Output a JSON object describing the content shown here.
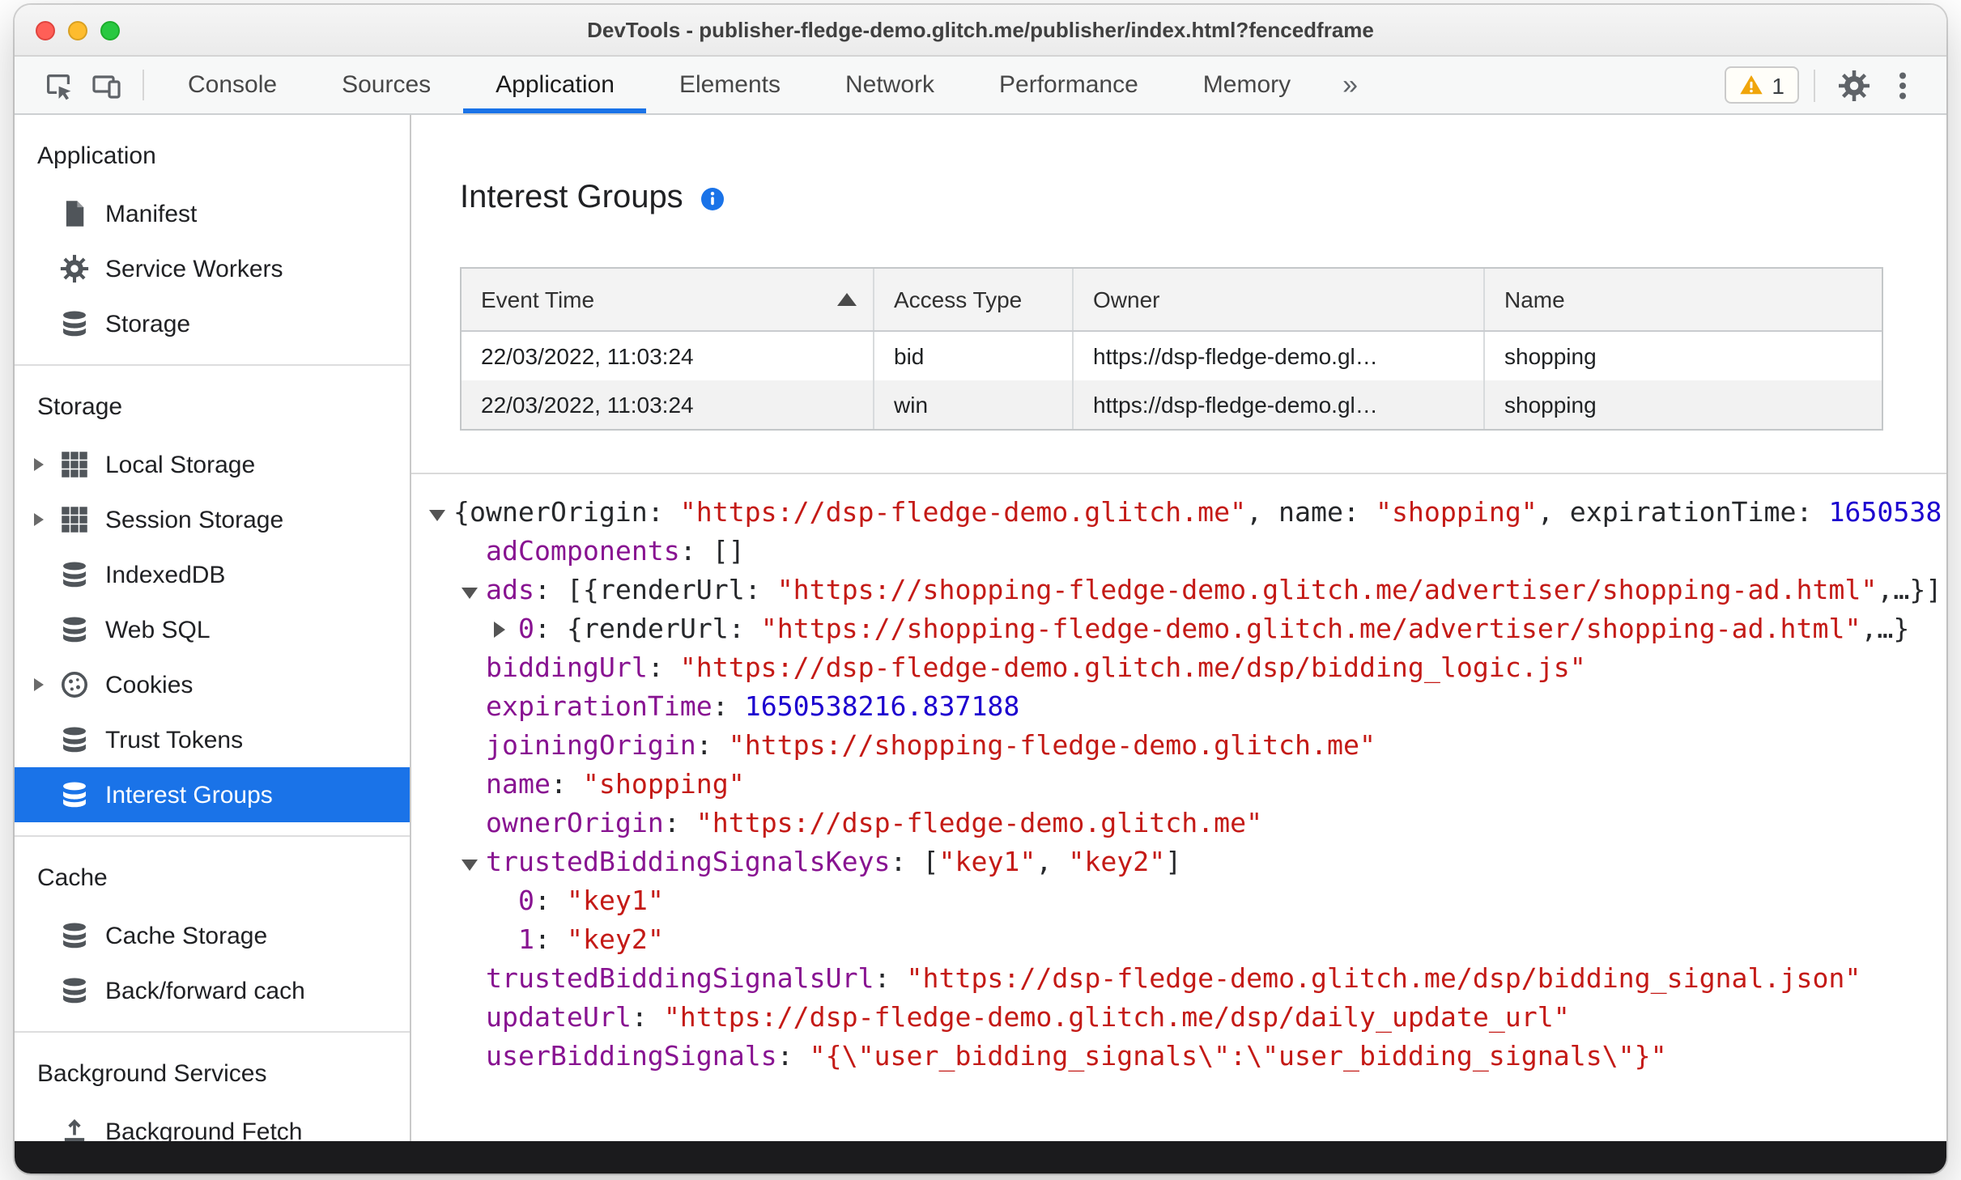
{
  "window": {
    "title": "DevTools - publisher-fledge-demo.glitch.me/publisher/index.html?fencedframe"
  },
  "toolbar": {
    "tabs": [
      {
        "label": "Console",
        "active": false
      },
      {
        "label": "Sources",
        "active": false
      },
      {
        "label": "Application",
        "active": true
      },
      {
        "label": "Elements",
        "active": false
      },
      {
        "label": "Network",
        "active": false
      },
      {
        "label": "Performance",
        "active": false
      },
      {
        "label": "Memory",
        "active": false
      }
    ],
    "more_tabs_symbol": "»",
    "warning_count": "1"
  },
  "sidebar": {
    "sections": [
      {
        "heading": "Application",
        "items": [
          {
            "label": "Manifest",
            "icon": "document-icon"
          },
          {
            "label": "Service Workers",
            "icon": "gear-icon"
          },
          {
            "label": "Storage",
            "icon": "database-icon"
          }
        ]
      },
      {
        "heading": "Storage",
        "items": [
          {
            "label": "Local Storage",
            "icon": "table-icon",
            "expandable": true
          },
          {
            "label": "Session Storage",
            "icon": "table-icon",
            "expandable": true
          },
          {
            "label": "IndexedDB",
            "icon": "database-icon"
          },
          {
            "label": "Web SQL",
            "icon": "database-icon"
          },
          {
            "label": "Cookies",
            "icon": "cookie-icon",
            "expandable": true
          },
          {
            "label": "Trust Tokens",
            "icon": "database-icon"
          },
          {
            "label": "Interest Groups",
            "icon": "database-icon",
            "selected": true
          }
        ]
      },
      {
        "heading": "Cache",
        "items": [
          {
            "label": "Cache Storage",
            "icon": "database-icon"
          },
          {
            "label": "Back/forward cach",
            "icon": "database-icon"
          }
        ]
      },
      {
        "heading": "Background Services",
        "items": [
          {
            "label": "Background Fetch",
            "icon": "fetch-icon"
          }
        ]
      }
    ]
  },
  "main": {
    "title": "Interest Groups",
    "table": {
      "columns": [
        "Event Time",
        "Access Type",
        "Owner",
        "Name"
      ],
      "sorted_column": "Event Time",
      "sort_direction": "ascending",
      "rows": [
        [
          "22/03/2022, 11:03:24",
          "bid",
          "https://dsp-fledge-demo.gl…",
          "shopping"
        ],
        [
          "22/03/2022, 11:03:24",
          "win",
          "https://dsp-fledge-demo.gl…",
          "shopping"
        ]
      ]
    },
    "tree": {
      "lines": [
        {
          "indent": 0,
          "arrow": "down",
          "segments": [
            {
              "t": "{ownerOrigin: ",
              "c": "p"
            },
            {
              "t": "\"https://dsp-fledge-demo.glitch.me\"",
              "c": "s"
            },
            {
              "t": ", name: ",
              "c": "p"
            },
            {
              "t": "\"shopping\"",
              "c": "s"
            },
            {
              "t": ", expirationTime: ",
              "c": "p"
            },
            {
              "t": "1650538",
              "c": "n"
            }
          ]
        },
        {
          "indent": 1,
          "arrow": null,
          "segments": [
            {
              "t": "adComponents",
              "c": "k"
            },
            {
              "t": ": []",
              "c": "p"
            }
          ]
        },
        {
          "indent": 1,
          "arrow": "down",
          "segments": [
            {
              "t": "ads",
              "c": "k"
            },
            {
              "t": ": [{renderUrl: ",
              "c": "p"
            },
            {
              "t": "\"https://shopping-fledge-demo.glitch.me/advertiser/shopping-ad.html\"",
              "c": "s"
            },
            {
              "t": ",…}]",
              "c": "p"
            }
          ]
        },
        {
          "indent": 2,
          "arrow": "right",
          "segments": [
            {
              "t": "0",
              "c": "k"
            },
            {
              "t": ": {renderUrl: ",
              "c": "p"
            },
            {
              "t": "\"https://shopping-fledge-demo.glitch.me/advertiser/shopping-ad.html\"",
              "c": "s"
            },
            {
              "t": ",…}",
              "c": "p"
            }
          ]
        },
        {
          "indent": 1,
          "arrow": null,
          "segments": [
            {
              "t": "biddingUrl",
              "c": "k"
            },
            {
              "t": ": ",
              "c": "p"
            },
            {
              "t": "\"https://dsp-fledge-demo.glitch.me/dsp/bidding_logic.js\"",
              "c": "s"
            }
          ]
        },
        {
          "indent": 1,
          "arrow": null,
          "segments": [
            {
              "t": "expirationTime",
              "c": "k"
            },
            {
              "t": ": ",
              "c": "p"
            },
            {
              "t": "1650538216.837188",
              "c": "n"
            }
          ]
        },
        {
          "indent": 1,
          "arrow": null,
          "segments": [
            {
              "t": "joiningOrigin",
              "c": "k"
            },
            {
              "t": ": ",
              "c": "p"
            },
            {
              "t": "\"https://shopping-fledge-demo.glitch.me\"",
              "c": "s"
            }
          ]
        },
        {
          "indent": 1,
          "arrow": null,
          "segments": [
            {
              "t": "name",
              "c": "k"
            },
            {
              "t": ": ",
              "c": "p"
            },
            {
              "t": "\"shopping\"",
              "c": "s"
            }
          ]
        },
        {
          "indent": 1,
          "arrow": null,
          "segments": [
            {
              "t": "ownerOrigin",
              "c": "k"
            },
            {
              "t": ": ",
              "c": "p"
            },
            {
              "t": "\"https://dsp-fledge-demo.glitch.me\"",
              "c": "s"
            }
          ]
        },
        {
          "indent": 1,
          "arrow": "down",
          "segments": [
            {
              "t": "trustedBiddingSignalsKeys",
              "c": "k"
            },
            {
              "t": ": [",
              "c": "p"
            },
            {
              "t": "\"key1\"",
              "c": "s"
            },
            {
              "t": ", ",
              "c": "p"
            },
            {
              "t": "\"key2\"",
              "c": "s"
            },
            {
              "t": "]",
              "c": "p"
            }
          ]
        },
        {
          "indent": 2,
          "arrow": null,
          "segments": [
            {
              "t": "0",
              "c": "k"
            },
            {
              "t": ": ",
              "c": "p"
            },
            {
              "t": "\"key1\"",
              "c": "s"
            }
          ]
        },
        {
          "indent": 2,
          "arrow": null,
          "segments": [
            {
              "t": "1",
              "c": "k"
            },
            {
              "t": ": ",
              "c": "p"
            },
            {
              "t": "\"key2\"",
              "c": "s"
            }
          ]
        },
        {
          "indent": 1,
          "arrow": null,
          "segments": [
            {
              "t": "trustedBiddingSignalsUrl",
              "c": "k"
            },
            {
              "t": ": ",
              "c": "p"
            },
            {
              "t": "\"https://dsp-fledge-demo.glitch.me/dsp/bidding_signal.json\"",
              "c": "s"
            }
          ]
        },
        {
          "indent": 1,
          "arrow": null,
          "segments": [
            {
              "t": "updateUrl",
              "c": "k"
            },
            {
              "t": ": ",
              "c": "p"
            },
            {
              "t": "\"https://dsp-fledge-demo.glitch.me/dsp/daily_update_url\"",
              "c": "s"
            }
          ]
        },
        {
          "indent": 1,
          "arrow": null,
          "segments": [
            {
              "t": "userBiddingSignals",
              "c": "k"
            },
            {
              "t": ": ",
              "c": "p"
            },
            {
              "t": "\"{\\\"user_bidding_signals\\\":\\\"user_bidding_signals\\\"}\"",
              "c": "s"
            }
          ]
        }
      ]
    }
  },
  "colors": {
    "accent": "#1a73e8",
    "selection_background": "#1a73e8",
    "tree_key": "#881391",
    "tree_string": "#c41a16",
    "tree_number": "#1c00cf",
    "warning": "#f0a50a"
  }
}
